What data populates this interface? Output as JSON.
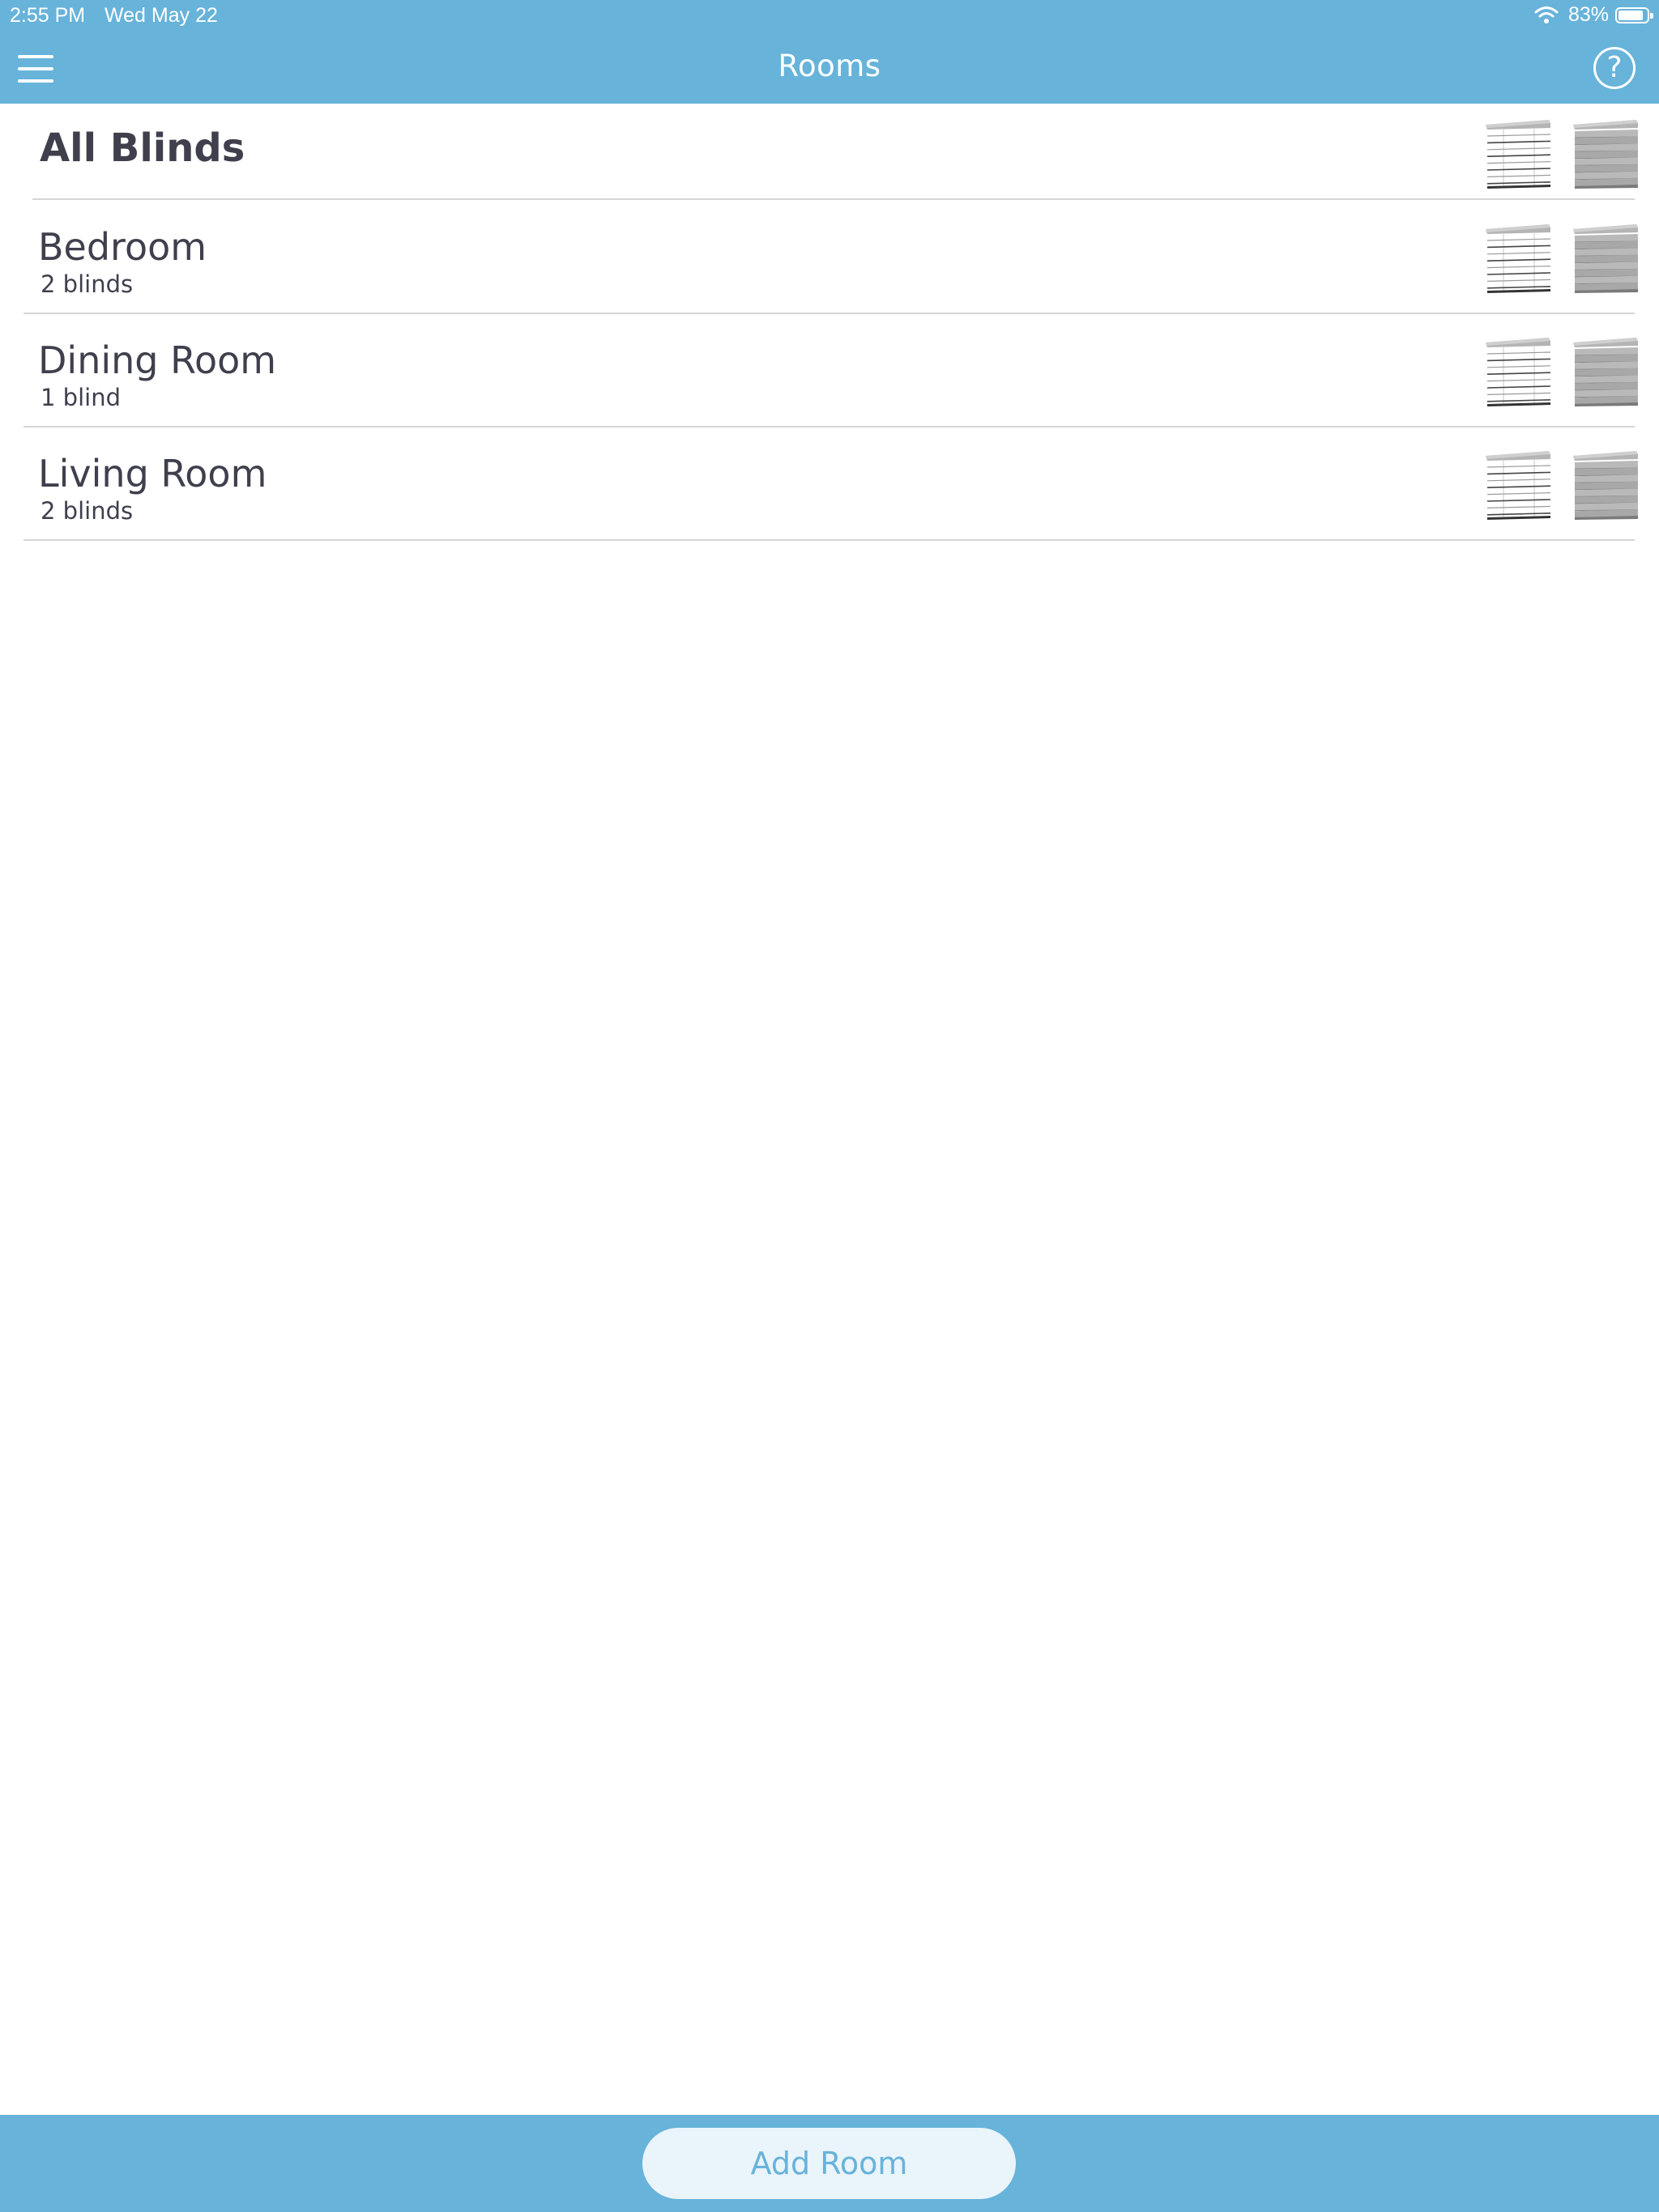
{
  "status_bar": {
    "time": "2:55 PM",
    "date": "Wed May 22",
    "battery_text": "83%",
    "battery_level": 0.83
  },
  "nav": {
    "title": "Rooms",
    "menu_icon": "hamburger-icon",
    "help_icon": "help-icon",
    "help_glyph": "?"
  },
  "colors": {
    "accent": "#67b3da",
    "text": "#3f3f4d",
    "button_bg": "#eaf4fb",
    "divider": "#d6d6d6"
  },
  "rooms": [
    {
      "name": "All Blinds",
      "count": ""
    },
    {
      "name": "Bedroom",
      "count": "2 blinds"
    },
    {
      "name": "Dining Room",
      "count": "1 blind"
    },
    {
      "name": "Living Room",
      "count": "2 blinds"
    }
  ],
  "row_icons": {
    "open": "blind-open-icon",
    "closed": "blind-closed-icon"
  },
  "footer": {
    "add_room_label": "Add Room"
  }
}
